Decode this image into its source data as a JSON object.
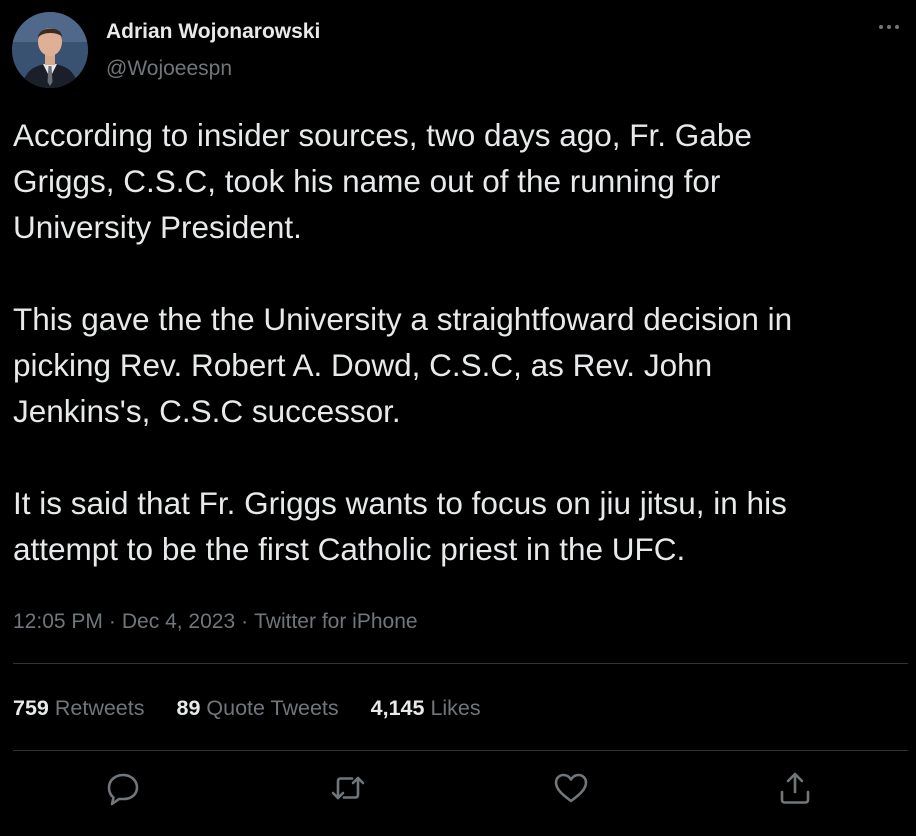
{
  "author": {
    "display_name": "Adrian Wojonarowski",
    "handle": "@Wojoeespn"
  },
  "tweet": {
    "paragraphs": [
      "According to insider sources, two days ago, Fr. Gabe\nGriggs, C.S.C, took his name out of the running for\nUniversity President.",
      "This gave the the University a straightfoward decision in\npicking Rev. Robert A. Dowd, C.S.C, as Rev. John\nJenkins's, C.S.C successor.",
      "It is said that Fr. Griggs wants to focus on jiu jitsu, in his\nattempt to be the first Catholic priest in the UFC."
    ]
  },
  "meta": {
    "time": "12:05 PM",
    "separator": "·",
    "date": "Dec 4, 2023",
    "source": "Twitter for iPhone"
  },
  "stats": {
    "retweets_count": "759",
    "retweets_label": "Retweets",
    "quote_count": "89",
    "quote_label": "Quote Tweets",
    "likes_count": "4,145",
    "likes_label": "Likes"
  },
  "actions": {
    "icons": [
      "reply-icon",
      "retweet-icon",
      "like-icon",
      "share-icon"
    ]
  },
  "colors": {
    "background": "#000000",
    "text": "#e7e9ea",
    "secondary": "#71767b",
    "divider": "#2f3336"
  }
}
